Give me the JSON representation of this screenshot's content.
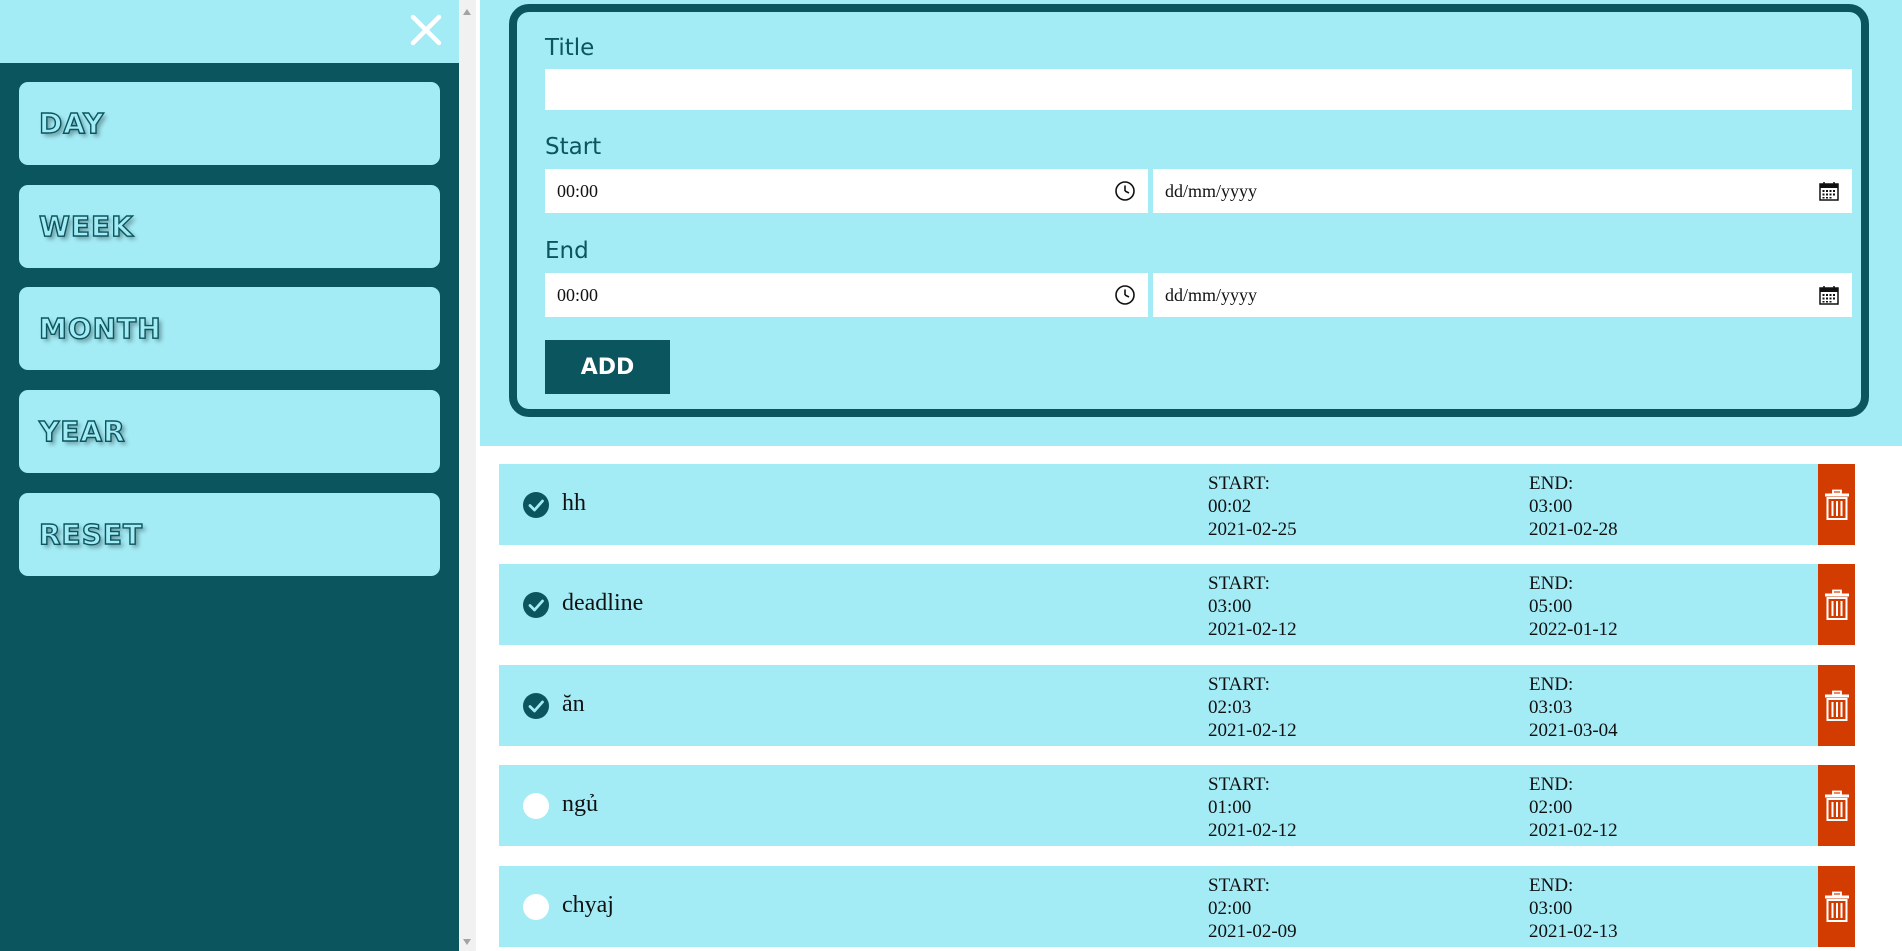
{
  "sidebar": {
    "close_icon": "close-icon",
    "items": [
      {
        "label": "DAY"
      },
      {
        "label": "WEEK"
      },
      {
        "label": "MONTH"
      },
      {
        "label": "YEAR"
      },
      {
        "label": "RESET"
      }
    ]
  },
  "form": {
    "title_label": "Title",
    "title_value": "",
    "start_label": "Start",
    "start_time": "00:00",
    "start_date_placeholder": "dd/mm/yyyy",
    "end_label": "End",
    "end_time": "00:00",
    "end_date_placeholder": "dd/mm/yyyy",
    "add_label": "ADD"
  },
  "tasks": [
    {
      "title": "hh",
      "done": true,
      "start_label": "START:",
      "start_time": "00:02",
      "start_date": "2021-02-25",
      "end_label": "END:",
      "end_time": "03:00",
      "end_date": "2021-02-28"
    },
    {
      "title": "deadline",
      "done": true,
      "start_label": "START:",
      "start_time": "03:00",
      "start_date": "2021-02-12",
      "end_label": "END:",
      "end_time": "05:00",
      "end_date": "2022-01-12"
    },
    {
      "title": "ăn",
      "done": true,
      "start_label": "START:",
      "start_time": "02:03",
      "start_date": "2021-02-12",
      "end_label": "END:",
      "end_time": "03:03",
      "end_date": "2021-03-04"
    },
    {
      "title": "ngủ",
      "done": false,
      "start_label": "START:",
      "start_time": "01:00",
      "start_date": "2021-02-12",
      "end_label": "END:",
      "end_time": "02:00",
      "end_date": "2021-02-12"
    },
    {
      "title": "chyaj",
      "done": false,
      "start_label": "START:",
      "start_time": "02:00",
      "start_date": "2021-02-09",
      "end_label": "END:",
      "end_time": "03:00",
      "end_date": "2021-02-13"
    }
  ],
  "colors": {
    "dark_teal": "#0b555e",
    "light_cyan": "#a3ebf5",
    "delete_red": "#d23c00"
  }
}
